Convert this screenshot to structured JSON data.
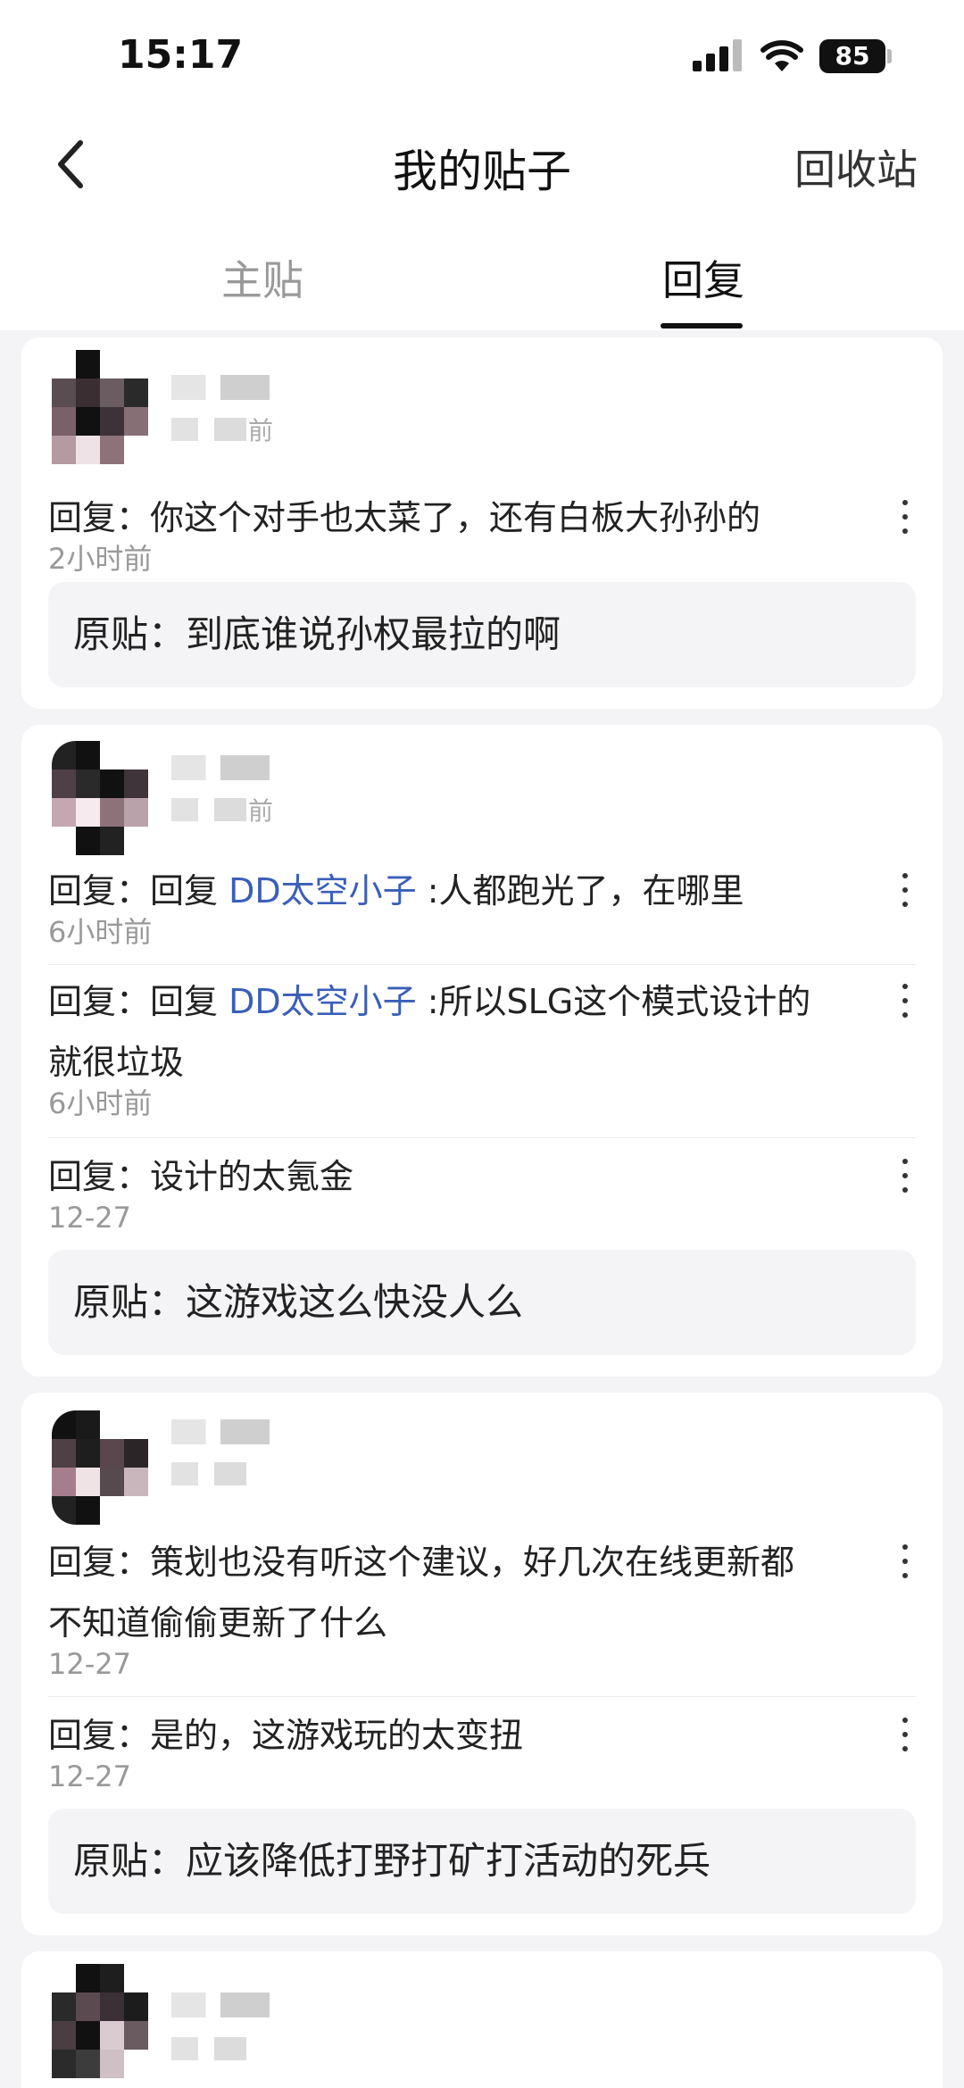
{
  "status": {
    "time": "15:17",
    "battery": "85"
  },
  "nav": {
    "title": "我的贴子",
    "recycle": "回收站"
  },
  "tabs": [
    {
      "label": "主贴"
    },
    {
      "label": "回复"
    }
  ],
  "cards": [
    {
      "user_time_suffix": "前",
      "replies": [
        {
          "prefix": "回复：",
          "text": "你这个对手也太菜了，还有白板大孙孙的",
          "time": "2小时前"
        }
      ],
      "original": "原贴：到底谁说孙权最拉的啊"
    },
    {
      "user_time_suffix": "前",
      "replies": [
        {
          "prefix": "回复：回复 ",
          "mention": "DD太空小子",
          "text": " :人都跑光了，在哪里",
          "time": "6小时前"
        },
        {
          "prefix": "回复：回复 ",
          "mention": "DD太空小子",
          "text": " :所以SLG这个模式设计的就很垃圾",
          "time": "6小时前"
        },
        {
          "prefix": "回复：",
          "text": "设计的太氪金",
          "time": "12-27"
        }
      ],
      "original": "原贴：这游戏这么快没人么"
    },
    {
      "user_time_suffix": "",
      "replies": [
        {
          "prefix": "回复：",
          "text": "策划也没有听这个建议，好几次在线更新都不知道偷偷更新了什么",
          "time": "12-27"
        },
        {
          "prefix": "回复：",
          "text": "是的，这游戏玩的太变扭",
          "time": "12-27"
        }
      ],
      "original": "原贴：应该降低打野打矿打活动的死兵"
    }
  ]
}
